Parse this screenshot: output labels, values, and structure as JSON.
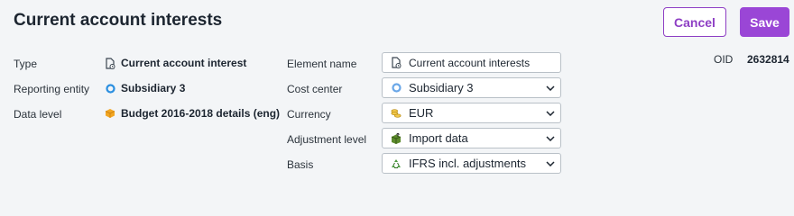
{
  "header": {
    "title": "Current account interests",
    "cancel_label": "Cancel",
    "save_label": "Save"
  },
  "colors": {
    "accent": "#9a46d6",
    "background": "#f3f5f7"
  },
  "info": {
    "type": {
      "label": "Type",
      "value": "Current account interest",
      "icon": "document-clock-icon"
    },
    "reporting_entity": {
      "label": "Reporting entity",
      "value": "Subsidiary 3",
      "icon": "circle-icon"
    },
    "data_level": {
      "label": "Data level",
      "value": "Budget 2016-2018 details (eng)",
      "icon": "cube-icon"
    }
  },
  "form": {
    "element_name": {
      "label": "Element name",
      "value": "Current account interests",
      "icon": "document-clock-icon"
    },
    "cost_center": {
      "label": "Cost center",
      "value": "Subsidiary 3",
      "icon": "circle-icon"
    },
    "currency": {
      "label": "Currency",
      "value": "EUR",
      "icon": "coins-icon"
    },
    "adjustment_level": {
      "label": "Adjustment level",
      "value": "Import data",
      "icon": "box-arrow-icon"
    },
    "basis": {
      "label": "Basis",
      "value": "IFRS incl. adjustments",
      "icon": "recycle-icon"
    }
  },
  "oid": {
    "label": "OID",
    "value": "2632814"
  }
}
